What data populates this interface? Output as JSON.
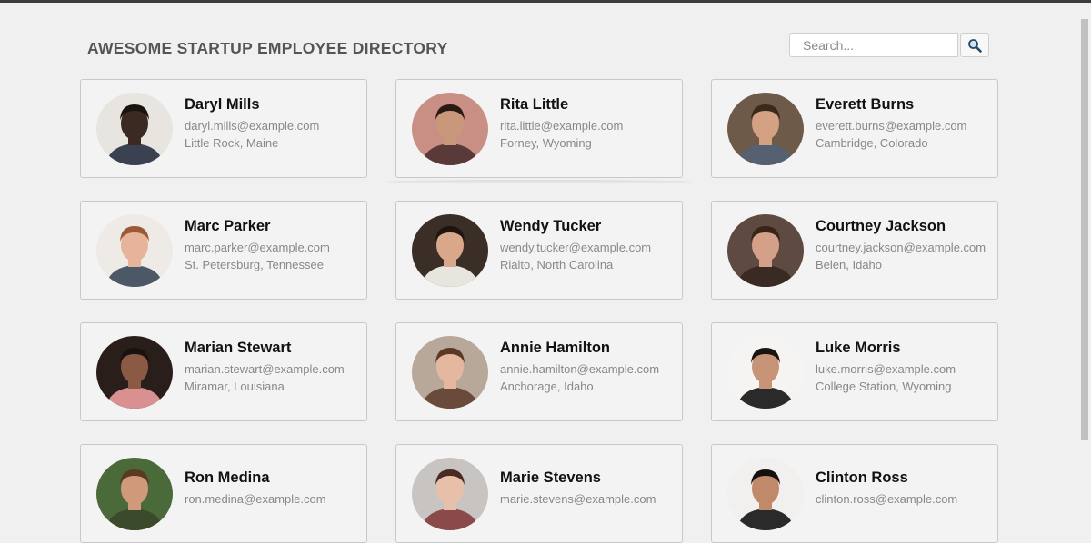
{
  "header": {
    "title": "AWESOME STARTUP EMPLOYEE DIRECTORY"
  },
  "search": {
    "placeholder": "Search..."
  },
  "employees": [
    {
      "name": "Daryl Mills",
      "email": "daryl.mills@example.com",
      "location": "Little Rock, Maine",
      "skin": "#3b2a22",
      "hair": "#1a1410",
      "bg": "#e8e4e0",
      "shirt": "#3a4252"
    },
    {
      "name": "Rita Little",
      "email": "rita.little@example.com",
      "location": "Forney, Wyoming",
      "skin": "#c9977a",
      "hair": "#2a1a14",
      "bg": "#c98f84",
      "shirt": "#5a3a38"
    },
    {
      "name": "Everett Burns",
      "email": "everett.burns@example.com",
      "location": "Cambridge, Colorado",
      "skin": "#d4a183",
      "hair": "#3a2a1a",
      "bg": "#6e5a48",
      "shirt": "#556070"
    },
    {
      "name": "Marc Parker",
      "email": "marc.parker@example.com",
      "location": "St. Petersburg, Tennessee",
      "skin": "#e6b49a",
      "hair": "#9a5a34",
      "bg": "#eeeae6",
      "shirt": "#4c5866"
    },
    {
      "name": "Wendy Tucker",
      "email": "wendy.tucker@example.com",
      "location": "Rialto, North Carolina",
      "skin": "#d9a88a",
      "hair": "#1e1510",
      "bg": "#3a2e26",
      "shirt": "#e8e4de"
    },
    {
      "name": "Courtney Jackson",
      "email": "courtney.jackson@example.com",
      "location": "Belen, Idaho",
      "skin": "#d4a088",
      "hair": "#3a2418",
      "bg": "#5e4a40",
      "shirt": "#3a2a24"
    },
    {
      "name": "Marian Stewart",
      "email": "marian.stewart@example.com",
      "location": "Miramar, Louisiana",
      "skin": "#8a5a44",
      "hair": "#1a1210",
      "bg": "#2a1e1a",
      "shirt": "#d89090"
    },
    {
      "name": "Annie Hamilton",
      "email": "annie.hamilton@example.com",
      "location": "Anchorage, Idaho",
      "skin": "#e4b89e",
      "hair": "#5a3a26",
      "bg": "#b8a89a",
      "shirt": "#6a4a3a"
    },
    {
      "name": "Luke Morris",
      "email": "luke.morris@example.com",
      "location": "College Station, Wyoming",
      "skin": "#c79478",
      "hair": "#1a1410",
      "bg": "#f6f4f2",
      "shirt": "#2a2a2a"
    },
    {
      "name": "Ron Medina",
      "email": "ron.medina@example.com",
      "location": "",
      "skin": "#d09a7a",
      "hair": "#5a3a22",
      "bg": "#4a6a3a",
      "shirt": "#3a4a2a"
    },
    {
      "name": "Marie Stevens",
      "email": "marie.stevens@example.com",
      "location": "",
      "skin": "#e8c0aa",
      "hair": "#4a2a22",
      "bg": "#c8c4c2",
      "shirt": "#8a4a4a"
    },
    {
      "name": "Clinton Ross",
      "email": "clinton.ross@example.com",
      "location": "",
      "skin": "#c08a6a",
      "hair": "#141010",
      "bg": "#f2f0ee",
      "shirt": "#2a2a2a"
    }
  ]
}
